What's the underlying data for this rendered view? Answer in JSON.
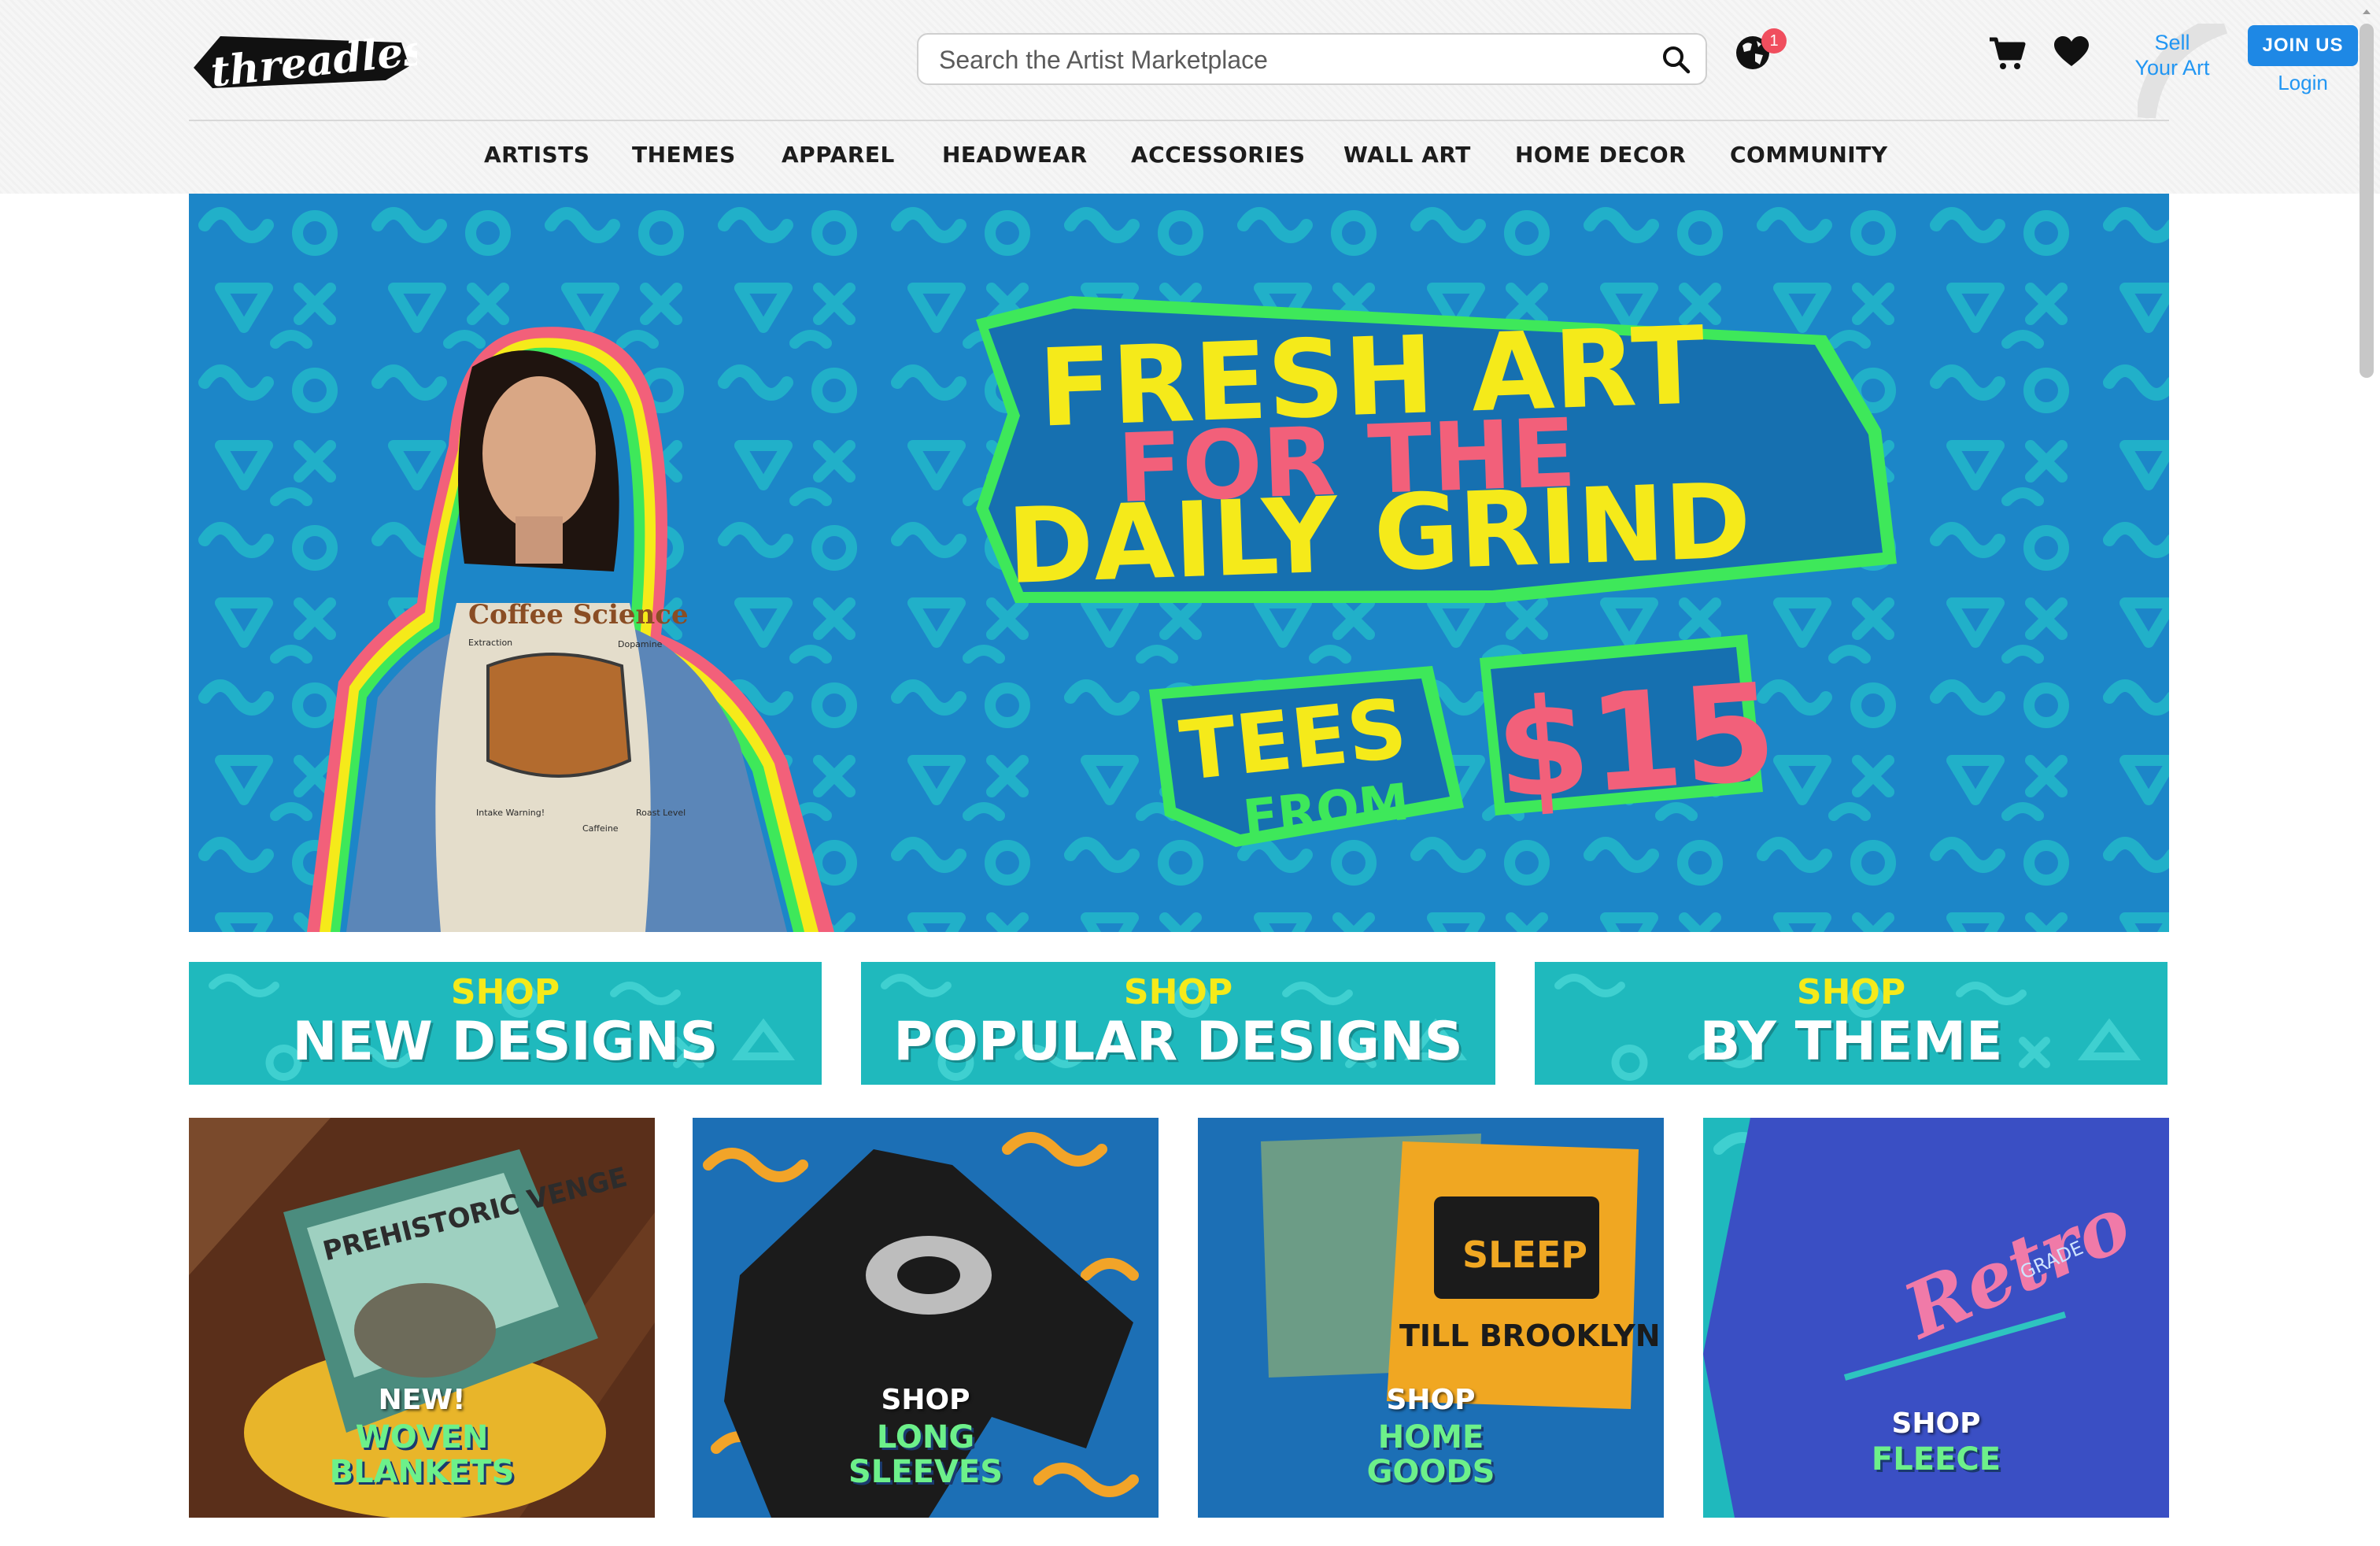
{
  "header": {
    "logo_text": "threadless",
    "search": {
      "placeholder": "Search the Artist Marketplace",
      "value": ""
    },
    "notification_badge": "1",
    "sell_line1": "Sell",
    "sell_line2": "Your Art",
    "join_label": "JOIN US",
    "login_label": "Login"
  },
  "nav": {
    "items": [
      "ARTISTS",
      "THEMES",
      "APPAREL",
      "HEADWEAR",
      "ACCESSORIES",
      "WALL ART",
      "HOME DECOR",
      "COMMUNITY"
    ]
  },
  "hero": {
    "headline_1": "FRESH ART",
    "headline_2": "FOR THE",
    "headline_3": "DAILY GRIND",
    "tees": "TEES",
    "from": "FROM",
    "price": "$15",
    "shirt_title": "Coffee Science",
    "shirt_labels": [
      "Extraction",
      "Dopamine",
      "Intake Warning!",
      "Caffeine",
      "Roast Level"
    ]
  },
  "shop_banners": [
    {
      "top": "SHOP",
      "bottom": "NEW DESIGNS"
    },
    {
      "top": "SHOP",
      "bottom": "POPULAR DESIGNS"
    },
    {
      "top": "SHOP",
      "bottom": "BY THEME"
    }
  ],
  "tiles": [
    {
      "top": "NEW!",
      "line1": "WOVEN",
      "line2": "BLANKETS",
      "art": "PREHISTORIC VENGE"
    },
    {
      "top": "SHOP",
      "line1": "LONG",
      "line2": "SLEEVES"
    },
    {
      "top": "SHOP",
      "line1": "HOME",
      "line2": "GOODS",
      "art_1": "SLEEP",
      "art_2": "TILL BROOKLYN"
    },
    {
      "top": "SHOP",
      "line1": "FLEECE",
      "line2": "",
      "art_1": "Retro",
      "art_2": "GRADE"
    }
  ],
  "colors": {
    "accent_blue": "#1e88e5",
    "link_blue": "#2196f3",
    "hero_bg": "#1c86c8",
    "teal": "#1fb9bd",
    "yellow": "#f5ea1a",
    "pink": "#f2607a",
    "green": "#3ee85a"
  }
}
